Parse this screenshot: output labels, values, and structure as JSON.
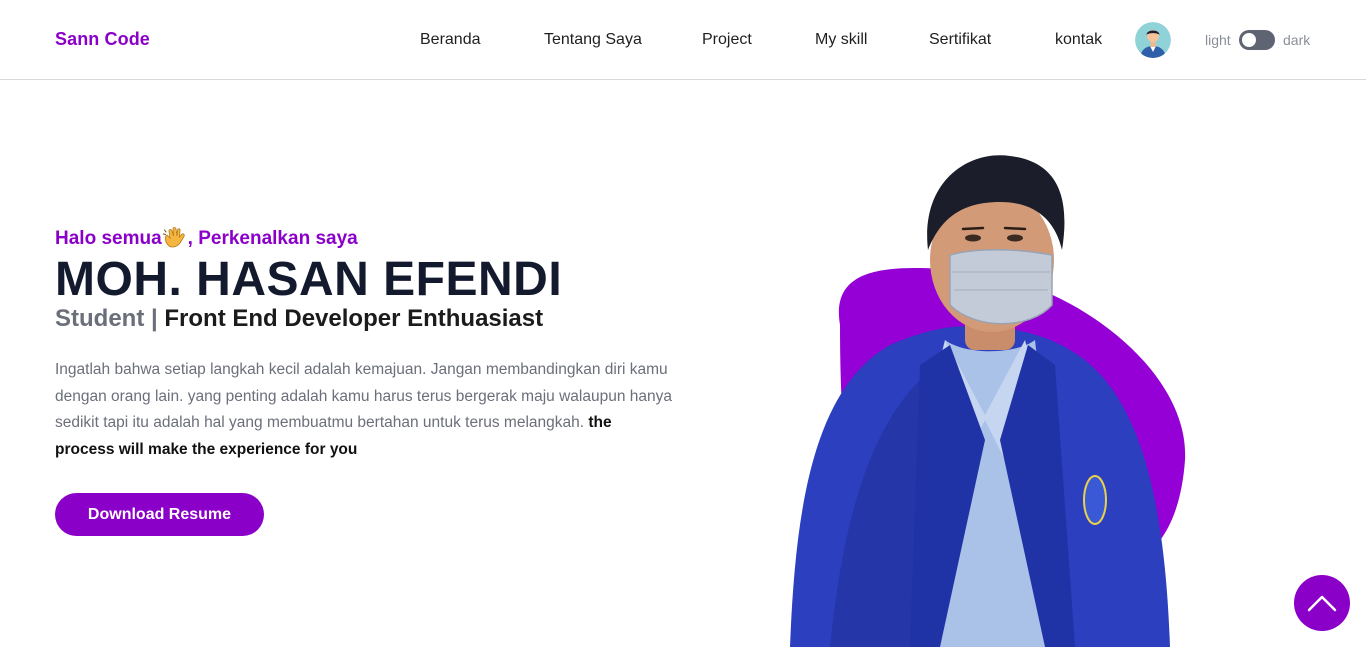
{
  "brand": {
    "logo": "Sann Code",
    "accent": "#8b00c9"
  },
  "nav": {
    "items": [
      {
        "label": "Beranda"
      },
      {
        "label": "Tentang Saya"
      },
      {
        "label": "Project"
      },
      {
        "label": "My skill"
      },
      {
        "label": "Sertifikat"
      },
      {
        "label": "kontak"
      }
    ],
    "avatar_icon": "user-avatar-icon",
    "theme_toggle": {
      "light_label": "light",
      "dark_label": "dark"
    }
  },
  "hero": {
    "greeting_before": "Halo semua",
    "greeting_emoji_icon": "waving-hand-icon",
    "greeting_after": ", Perkenalkan saya",
    "name": "MOH. HASAN EFENDI",
    "role_primary": "Student",
    "role_separator": "|",
    "role_secondary": "Front End Developer Enthuasiast",
    "description": "Ingatlah bahwa setiap langkah kecil adalah kemajuan. Jangan membandingkan diri kamu dengan orang lain. yang penting adalah kamu harus terus bergerak maju walaupun hanya sedikit tapi itu adalah hal yang membuatmu bertahan untuk terus melangkah.",
    "description_bold": "the process will make the experience for you",
    "download_label": "Download Resume",
    "photo_icon": "profile-photo-icon"
  },
  "scroll_top_icon": "chevron-up-icon"
}
